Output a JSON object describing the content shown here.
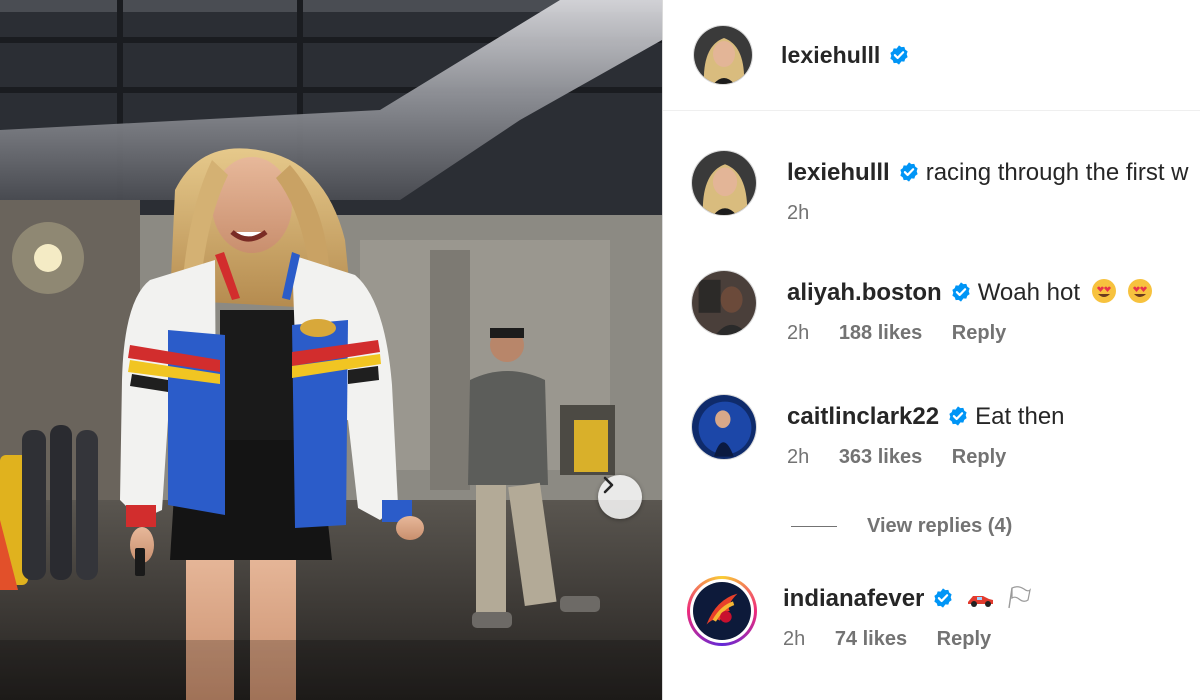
{
  "post": {
    "author": "lexiehulll",
    "author_verified": true
  },
  "photo": {
    "next_icon": "chevron-right-icon"
  },
  "comments": [
    {
      "username": "lexiehulll",
      "verified": true,
      "text": "racing through the first w",
      "time": "2h"
    },
    {
      "username": "aliyah.boston",
      "verified": true,
      "text": "Woah hot",
      "emojis": [
        "heart-eyes-emoji",
        "heart-eyes-emoji"
      ],
      "time": "2h",
      "likes": "188 likes",
      "reply": "Reply"
    },
    {
      "username": "caitlinclark22",
      "verified": true,
      "text": "Eat then",
      "time": "2h",
      "likes": "363 likes",
      "reply": "Reply"
    },
    {
      "username": "indianafever",
      "verified": true,
      "text": "",
      "emojis": [
        "race-car-emoji",
        "checkered-flag-emoji"
      ],
      "time": "2h",
      "likes": "74 likes",
      "reply": "Reply"
    }
  ],
  "view_replies": "View replies (4)",
  "colors": {
    "verified_blue": "#0095f6",
    "meta_grey": "#737373",
    "text_dark": "#262626"
  }
}
